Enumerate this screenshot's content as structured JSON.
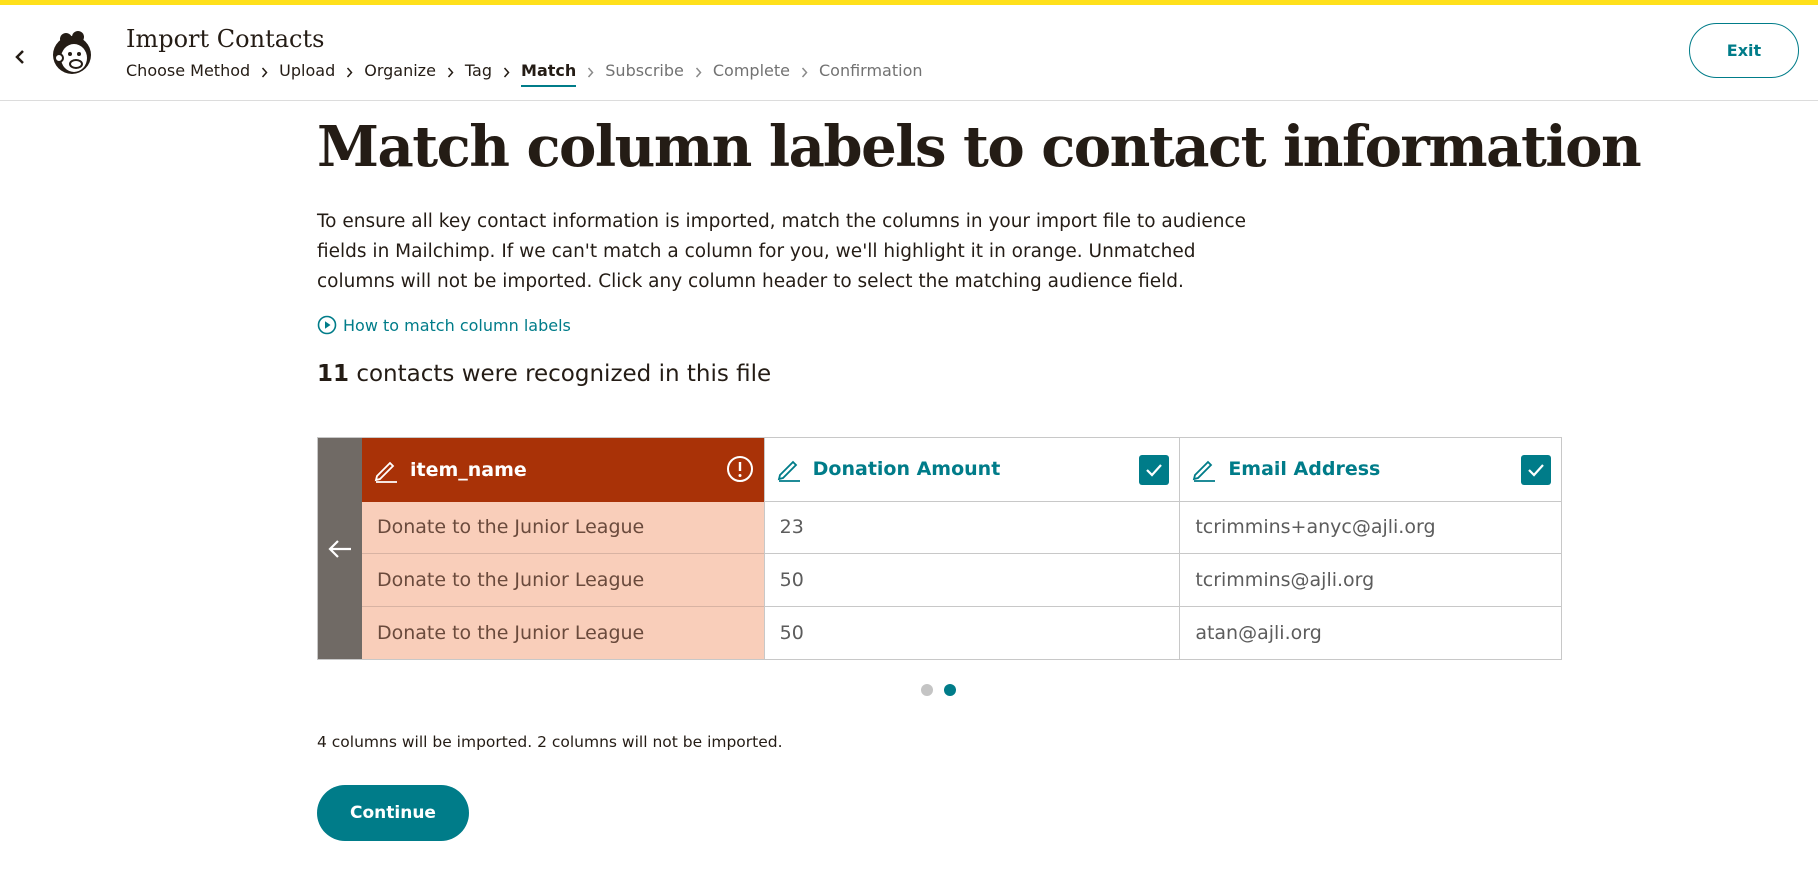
{
  "header": {
    "title": "Import Contacts",
    "exit_label": "Exit",
    "breadcrumb": [
      {
        "label": "Choose Method",
        "state": "done"
      },
      {
        "label": "Upload",
        "state": "done"
      },
      {
        "label": "Organize",
        "state": "done"
      },
      {
        "label": "Tag",
        "state": "done"
      },
      {
        "label": "Match",
        "state": "current"
      },
      {
        "label": "Subscribe",
        "state": "future"
      },
      {
        "label": "Complete",
        "state": "future"
      },
      {
        "label": "Confirmation",
        "state": "future"
      }
    ]
  },
  "main": {
    "title": "Match column labels to contact information",
    "intro": "To ensure all key contact information is imported, match the columns in your import file to audience fields in Mailchimp. If we can't match a column for you, we'll highlight it in orange. Unmatched columns will not be imported. Click any column header to select the matching audience field.",
    "help_link": "How to match column labels",
    "recognized_count": "11",
    "recognized_text": " contacts were recognized in this file",
    "table": {
      "columns": [
        {
          "header": "item_name",
          "status": "unmatched",
          "cells": [
            "Donate to the Junior League",
            "Donate to the Junior League",
            "Donate to the Junior League"
          ]
        },
        {
          "header": "Donation Amount",
          "status": "matched",
          "cells": [
            "23",
            "50",
            "50"
          ]
        },
        {
          "header": "Email Address",
          "status": "matched",
          "cells": [
            "tcrimmins+anyc@ajli.org",
            "tcrimmins@ajli.org",
            "atan@ajli.org"
          ]
        }
      ]
    },
    "pagination": {
      "pages": 2,
      "current": 2
    },
    "summary": "4 columns will be imported. 2 columns will not be imported.",
    "continue_label": "Continue"
  },
  "colors": {
    "accent": "#007c89",
    "unmatched_header": "#a93207",
    "unmatched_cell": "#f9ceba",
    "top_stripe": "#ffe01b"
  },
  "icons": [
    "back-chevron-icon",
    "mailchimp-logo",
    "chevron-right-icon",
    "play-circle-icon",
    "pencil-icon",
    "warning-circle-icon",
    "checkbox-checked-icon",
    "arrow-left-icon"
  ]
}
